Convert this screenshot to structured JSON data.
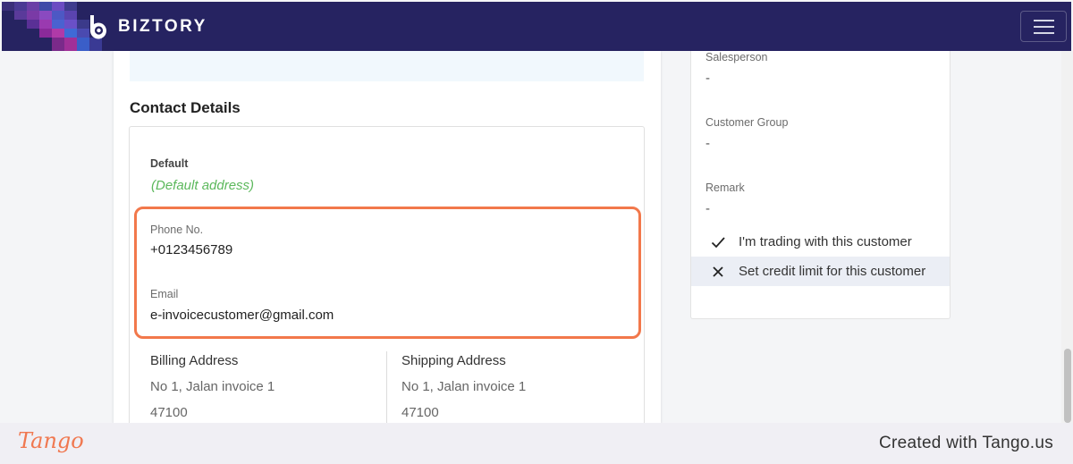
{
  "header": {
    "brand": "BIZTORY",
    "logo_icon": "biztory-logo-icon",
    "menu_icon": "hamburger-menu-icon"
  },
  "contact": {
    "section_title": "Contact Details",
    "default_label": "Default",
    "default_value": "(Default address)",
    "phone_label": "Phone No.",
    "phone_value": "+0123456789",
    "email_label": "Email",
    "email_value": "e-invoicecustomer@gmail.com",
    "billing": {
      "title": "Billing Address",
      "line1": "No 1, Jalan invoice 1",
      "line2": "47100"
    },
    "shipping": {
      "title": "Shipping Address",
      "line1": "No 1, Jalan invoice 1",
      "line2": "47100"
    }
  },
  "sidebar": {
    "salesperson_label": "Salesperson",
    "salesperson_value": "-",
    "customer_group_label": "Customer Group",
    "customer_group_value": "-",
    "remark_label": "Remark",
    "remark_value": "-",
    "options": [
      {
        "label": "I'm trading with this customer",
        "icon": "check-icon",
        "checked": true
      },
      {
        "label": "Set credit limit for this customer",
        "icon": "close-icon",
        "checked": false
      }
    ]
  },
  "footer": {
    "brand": "Tango",
    "credit": "Created with Tango.us"
  },
  "colors": {
    "header_bg": "#262361",
    "highlight": "#f2784b",
    "default_address": "#5cb85c",
    "tango": "#f07850"
  }
}
